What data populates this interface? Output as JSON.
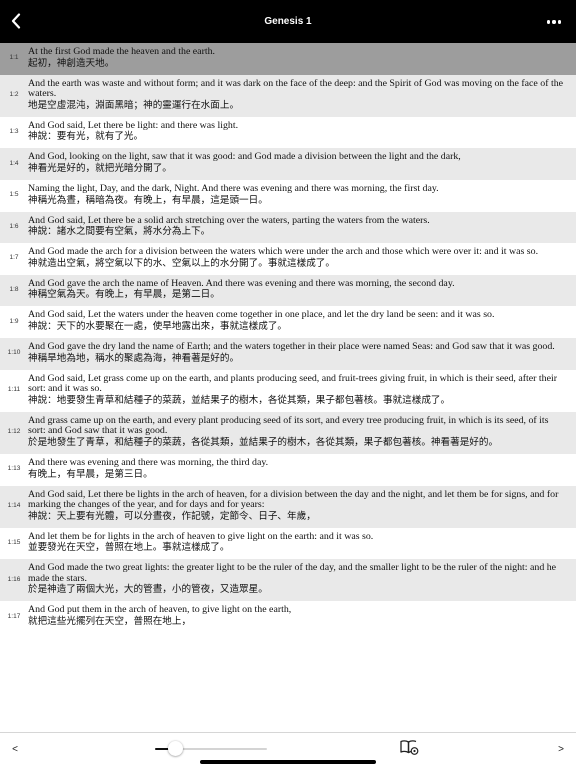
{
  "header": {
    "title": "Genesis 1"
  },
  "verses": [
    {
      "num": "1:1",
      "en": "At the first God made the heaven and the earth.",
      "zh": "起初，神創造天地。",
      "selected": true
    },
    {
      "num": "1:2",
      "en": "And the earth was waste and without form; and it was dark on the face of the deep: and the Spirit of God was moving on the face of the waters.",
      "zh": "地是空虛混沌，淵面黑暗；神的靈運行在水面上。"
    },
    {
      "num": "1:3",
      "en": "And God said, Let there be light: and there was light.",
      "zh": "神說：要有光，就有了光。"
    },
    {
      "num": "1:4",
      "en": "And God, looking on the light, saw that it was good: and God made a division between the light and the dark,",
      "zh": "神看光是好的，就把光暗分開了。"
    },
    {
      "num": "1:5",
      "en": "Naming the light, Day, and the dark, Night. And there was evening and there was morning, the first day.",
      "zh": "神稱光為晝，稱暗為夜。有晚上，有早晨，這是頭一日。"
    },
    {
      "num": "1:6",
      "en": "And God said, Let there be a solid arch stretching over the waters, parting the waters from the waters.",
      "zh": "神說：諸水之間要有空氣，將水分為上下。"
    },
    {
      "num": "1:7",
      "en": "And God made the arch for a division between the waters which were under the arch and those which were over it: and it was so.",
      "zh": "神就造出空氣，將空氣以下的水、空氣以上的水分開了。事就這樣成了。"
    },
    {
      "num": "1:8",
      "en": "And God gave the arch the name of Heaven. And there was evening and there was morning, the second day.",
      "zh": "神稱空氣為天。有晚上，有早晨，是第二日。"
    },
    {
      "num": "1:9",
      "en": "And God said, Let the waters under the heaven come together in one place, and let the dry land be seen: and it was so.",
      "zh": "神說：天下的水要聚在一處，使旱地露出來，事就這樣成了。"
    },
    {
      "num": "1:10",
      "en": "And God gave the dry land the name of Earth; and the waters together in their place were named Seas: and God saw that it was good.",
      "zh": "神稱旱地為地，稱水的聚處為海，神看著是好的。"
    },
    {
      "num": "1:11",
      "en": "And God said, Let grass come up on the earth, and plants producing seed, and fruit-trees giving fruit, in which is their seed, after their sort: and it was so.",
      "zh": "神說：地要發生青草和結種子的菜蔬，並結果子的樹木，各從其類，果子都包著核。事就這樣成了。"
    },
    {
      "num": "1:12",
      "en": "And grass came up on the earth, and every plant producing seed of its sort, and every tree producing fruit, in which is its seed, of its sort: and God saw that it was good.",
      "zh": "於是地發生了青草，和結種子的菜蔬，各從其類，並結果子的樹木，各從其類，果子都包著核。神看著是好的。"
    },
    {
      "num": "1:13",
      "en": "And there was evening and there was morning, the third day.",
      "zh": "有晚上，有早晨，是第三日。"
    },
    {
      "num": "1:14",
      "en": "And God said, Let there be lights in the arch of heaven, for a division between the day and the night, and let them be for signs, and for marking the changes of the year, and for days and for years:",
      "zh": "神說：天上要有光體，可以分晝夜，作記號，定節令、日子、年歲，"
    },
    {
      "num": "1:15",
      "en": "And let them be for lights in the arch of heaven to give light on the earth: and it was so.",
      "zh": "並要發光在天空，普照在地上。事就這樣成了。"
    },
    {
      "num": "1:16",
      "en": "And God made the two great lights: the greater light to be the ruler of the day, and the smaller light to be the ruler of the night: and he made the stars.",
      "zh": "於是神造了兩個大光，大的管晝，小的管夜，又造眾星。"
    },
    {
      "num": "1:17",
      "en": "And God put them in the arch of heaven, to give light on the earth,",
      "zh": "就把這些光擺列在天空，普照在地上，"
    }
  ],
  "footer": {
    "prev_label": "<",
    "next_label": ">",
    "font_size_level": 0.18
  },
  "icons": {
    "back": "chevron-left-icon",
    "more": "more-horizontal-icon",
    "book": "book-settings-icon"
  },
  "colors": {
    "header_bg": "#000000",
    "selected_row": "#9d9d9d",
    "alt_row": "#e9e9e9"
  }
}
